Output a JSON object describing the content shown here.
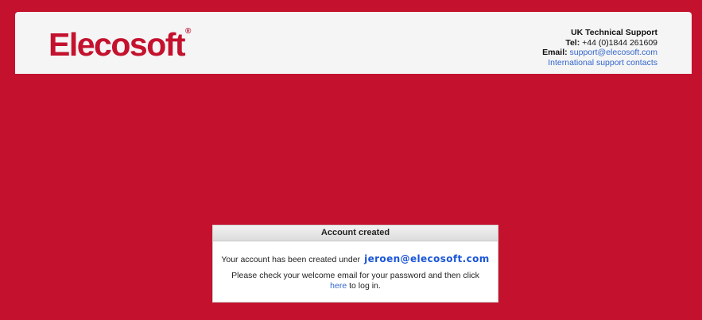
{
  "brand": {
    "name": "Elecosoft",
    "registered_mark": "®",
    "color": "#c4122e"
  },
  "support": {
    "title": "UK Technical Support",
    "tel_label": "Tel:",
    "tel_value": "+44 (0)1844 261609",
    "email_label": "Email:",
    "email_value": "support@elecosoft.com",
    "international_link": "International support contacts"
  },
  "dialog": {
    "title": "Account created",
    "created_text": "Your account has been created under",
    "account_email": "jeroen@elecosoft.com",
    "instructions_before": "Please check your welcome email for your password and then click",
    "here_link": "here",
    "instructions_after": "to log in."
  },
  "colors": {
    "background": "#c4122e",
    "link": "#3366cc",
    "account_email": "#1a55d8"
  }
}
